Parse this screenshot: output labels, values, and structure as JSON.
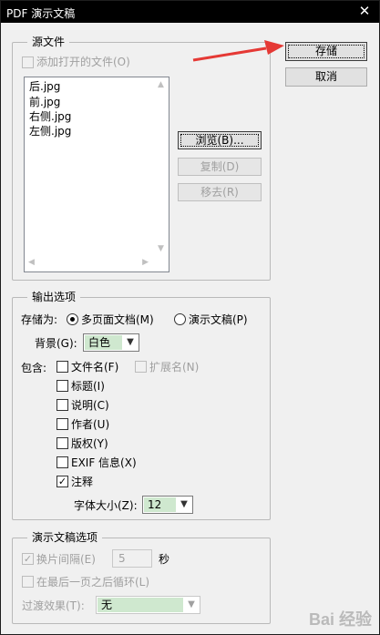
{
  "window": {
    "title": "PDF 演示文稿",
    "close_glyph": "✕"
  },
  "source_files": {
    "legend": "源文件",
    "add_open_files_label": "添加打开的文件(O)",
    "files": [
      "后.jpg",
      "前.jpg",
      "右侧.jpg",
      "左侧.jpg"
    ],
    "browse_label": "浏览(B)...",
    "duplicate_label": "复制(D)",
    "remove_label": "移去(R)"
  },
  "actions": {
    "save_label": "存储",
    "cancel_label": "取消"
  },
  "output_options": {
    "legend": "输出选项",
    "save_as_label": "存储为:",
    "multipage_label": "多页面文档(M)",
    "multipage_selected": true,
    "presentation_label": "演示文稿(P)",
    "background_label": "背景(G):",
    "background_value": "白色",
    "include_label": "包含:",
    "include": [
      {
        "label": "文件名(F)",
        "checked": false
      },
      {
        "label": "标题(I)",
        "checked": false
      },
      {
        "label": "说明(C)",
        "checked": false
      },
      {
        "label": "作者(U)",
        "checked": false
      },
      {
        "label": "版权(Y)",
        "checked": false
      },
      {
        "label": "EXIF 信息(X)",
        "checked": false
      },
      {
        "label": "注释",
        "checked": true
      }
    ],
    "extension_label": "扩展名(N)",
    "font_size_label": "字体大小(Z):",
    "font_size_value": "12"
  },
  "presentation_options": {
    "legend": "演示文稿选项",
    "advance_label": "换片间隔(E)",
    "advance_checked": true,
    "advance_value": "5",
    "seconds_label": "秒",
    "loop_label": "在最后一页之后循环(L)",
    "transition_label": "过渡效果(T):",
    "transition_value": "无"
  },
  "colors": {
    "select_highlight": "#cfe8cf",
    "annotation_arrow": "#e53935"
  },
  "watermark": "Bai 经验"
}
